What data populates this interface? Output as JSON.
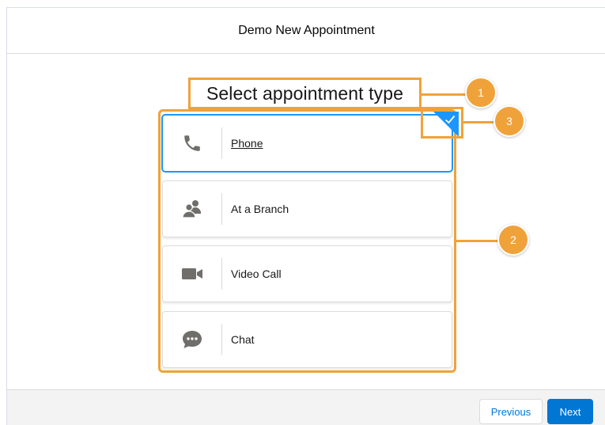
{
  "header": {
    "title": "Demo New Appointment"
  },
  "heading": "Select appointment type",
  "options": [
    {
      "label": "Phone",
      "icon": "phone-icon",
      "selected": true
    },
    {
      "label": "At a Branch",
      "icon": "people-icon",
      "selected": false
    },
    {
      "label": "Video Call",
      "icon": "video-camera-icon",
      "selected": false
    },
    {
      "label": "Chat",
      "icon": "chat-icon",
      "selected": false
    }
  ],
  "callouts": [
    "1",
    "2",
    "3"
  ],
  "footer": {
    "previous_label": "Previous",
    "next_label": "Next"
  },
  "colors": {
    "callout": "#f0a23a",
    "accent": "#0176d3",
    "selection": "#1b96ff",
    "icon": "#706e6b"
  }
}
